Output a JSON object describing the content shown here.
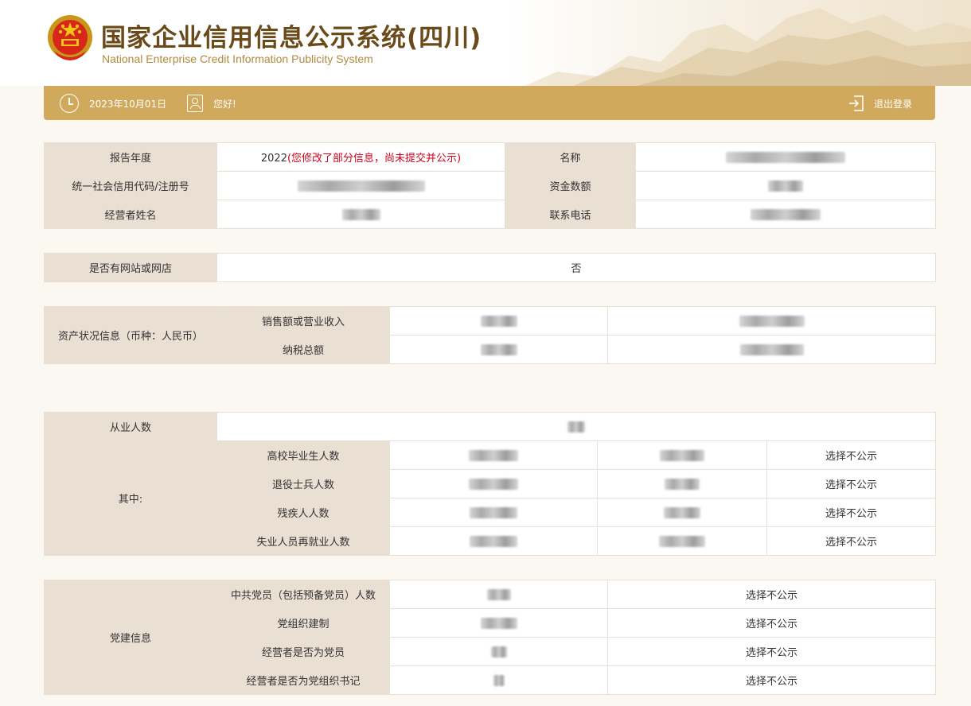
{
  "header": {
    "title_cn": "国家企业信用信息公示系统(四川)",
    "title_en": "National Enterprise Credit Information Publicity System"
  },
  "topbar": {
    "date": "2023年10月01日",
    "greeting": "您好!",
    "logout": "退出登录"
  },
  "basic": {
    "report_year_label": "报告年度",
    "report_year": "2022",
    "report_year_note": "(您修改了部分信息，尚未提交并公示)",
    "name_label": "名称",
    "credit_code_label": "统一社会信用代码/注册号",
    "capital_label": "资金数额",
    "operator_label": "经营者姓名",
    "phone_label": "联系电话"
  },
  "website": {
    "label": "是否有网站或网店",
    "value": "否"
  },
  "assets": {
    "label": "资产状况信息（币种：人民币）",
    "rows": [
      "销售额或营业收入",
      "纳税总额"
    ]
  },
  "employees": {
    "label": "从业人数",
    "among_label": "其中:",
    "rows": [
      "高校毕业生人数",
      "退役士兵人数",
      "残疾人人数",
      "失业人员再就业人数"
    ],
    "not_public": "选择不公示"
  },
  "party": {
    "label": "党建信息",
    "rows": [
      "中共党员（包括预备党员）人数",
      "党组织建制",
      "经营者是否为党员",
      "经营者是否为党组织书记"
    ],
    "not_public": "选择不公示"
  },
  "colors": {
    "accent_bar": "#d1a95c",
    "label_bg": "#e9dfd2",
    "title_brown": "#6b4a1a",
    "warning_red": "#d0021b"
  }
}
